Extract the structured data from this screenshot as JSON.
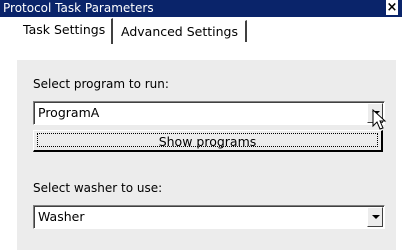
{
  "window": {
    "title": "Protocol Task Parameters",
    "close_glyph": "×"
  },
  "tabs": [
    {
      "label": "Task Settings",
      "active": true
    },
    {
      "label": "Advanced Settings",
      "active": false
    }
  ],
  "program": {
    "label": "Select program to run:",
    "value": "ProgramA",
    "button_label": "Show programs"
  },
  "washer": {
    "label": "Select washer to use:",
    "value": "Washer"
  },
  "icons": [
    "close-icon",
    "dropdown-arrow-icon",
    "mouse-cursor-icon"
  ],
  "colors": {
    "titlebar": "#0a246a",
    "panel": "#ececec"
  }
}
